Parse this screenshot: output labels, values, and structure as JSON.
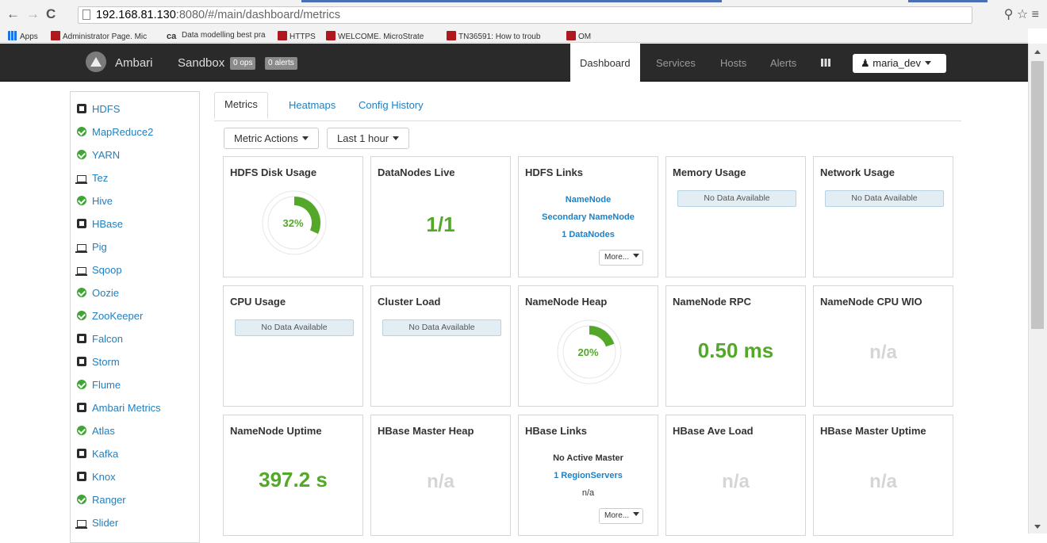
{
  "browser": {
    "url_host": "192.168.81.130",
    "url_rest": ":8080/#/main/dashboard/metrics",
    "bookmarks": [
      {
        "label": "Apps",
        "icon": "apps-icon"
      },
      {
        "label": "Administrator Page. Mic",
        "icon": "m-icon"
      },
      {
        "label": "Data modelling best pra",
        "icon": "ca-icon"
      },
      {
        "label": "HTTPS",
        "icon": "m-icon"
      },
      {
        "label": "WELCOME. MicroStrate",
        "icon": "m-icon"
      },
      {
        "label": "TN36591: How to troub",
        "icon": "m-icon"
      },
      {
        "label": "OM",
        "icon": "m-icon"
      }
    ]
  },
  "navbar": {
    "brand": "Ambari",
    "cluster": "Sandbox",
    "ops": "0 ops",
    "alerts_badge": "0 alerts",
    "items": [
      "Dashboard",
      "Services",
      "Hosts",
      "Alerts"
    ],
    "user": "maria_dev"
  },
  "sidebar": {
    "services": [
      {
        "name": "HDFS",
        "status": "maint"
      },
      {
        "name": "MapReduce2",
        "status": "ok"
      },
      {
        "name": "YARN",
        "status": "ok"
      },
      {
        "name": "Tez",
        "status": "client"
      },
      {
        "name": "Hive",
        "status": "ok"
      },
      {
        "name": "HBase",
        "status": "maint"
      },
      {
        "name": "Pig",
        "status": "client"
      },
      {
        "name": "Sqoop",
        "status": "client"
      },
      {
        "name": "Oozie",
        "status": "ok"
      },
      {
        "name": "ZooKeeper",
        "status": "ok"
      },
      {
        "name": "Falcon",
        "status": "maint"
      },
      {
        "name": "Storm",
        "status": "maint"
      },
      {
        "name": "Flume",
        "status": "ok"
      },
      {
        "name": "Ambari Metrics",
        "status": "maint"
      },
      {
        "name": "Atlas",
        "status": "ok"
      },
      {
        "name": "Kafka",
        "status": "maint"
      },
      {
        "name": "Knox",
        "status": "maint"
      },
      {
        "name": "Ranger",
        "status": "ok"
      },
      {
        "name": "Slider",
        "status": "client"
      }
    ]
  },
  "tabs": [
    "Metrics",
    "Heatmaps",
    "Config History"
  ],
  "toolbar": {
    "metric_actions": "Metric Actions",
    "time_range": "Last 1 hour"
  },
  "widgets": {
    "hdfs_disk": {
      "title": "HDFS Disk Usage",
      "percent": 32,
      "label": "32%"
    },
    "datanodes": {
      "title": "DataNodes Live",
      "value": "1/1"
    },
    "hdfs_links": {
      "title": "HDFS Links",
      "links": [
        "NameNode",
        "Secondary NameNode",
        "1 DataNodes"
      ],
      "more": "More..."
    },
    "memory": {
      "title": "Memory Usage",
      "message": "No Data Available"
    },
    "network": {
      "title": "Network Usage",
      "message": "No Data Available"
    },
    "cpu": {
      "title": "CPU Usage",
      "message": "No Data Available"
    },
    "cluster_load": {
      "title": "Cluster Load",
      "message": "No Data Available"
    },
    "nn_heap": {
      "title": "NameNode Heap",
      "percent": 20,
      "label": "20%"
    },
    "nn_rpc": {
      "title": "NameNode RPC",
      "value": "0.50 ms"
    },
    "nn_cpu": {
      "title": "NameNode CPU WIO",
      "value": "n/a"
    },
    "nn_uptime": {
      "title": "NameNode Uptime",
      "value": "397.2 s"
    },
    "hb_heap": {
      "title": "HBase Master Heap",
      "value": "n/a"
    },
    "hb_links": {
      "title": "HBase Links",
      "master": "No Active Master",
      "regions": "1 RegionServers",
      "extra": "n/a",
      "more": "More..."
    },
    "hb_load": {
      "title": "HBase Ave Load",
      "value": "n/a"
    },
    "hb_uptime": {
      "title": "HBase Master Uptime",
      "value": "n/a"
    }
  },
  "colors": {
    "accent_green": "#53a829",
    "link_blue": "#1e81c3",
    "navbar": "#2a2a2a"
  }
}
